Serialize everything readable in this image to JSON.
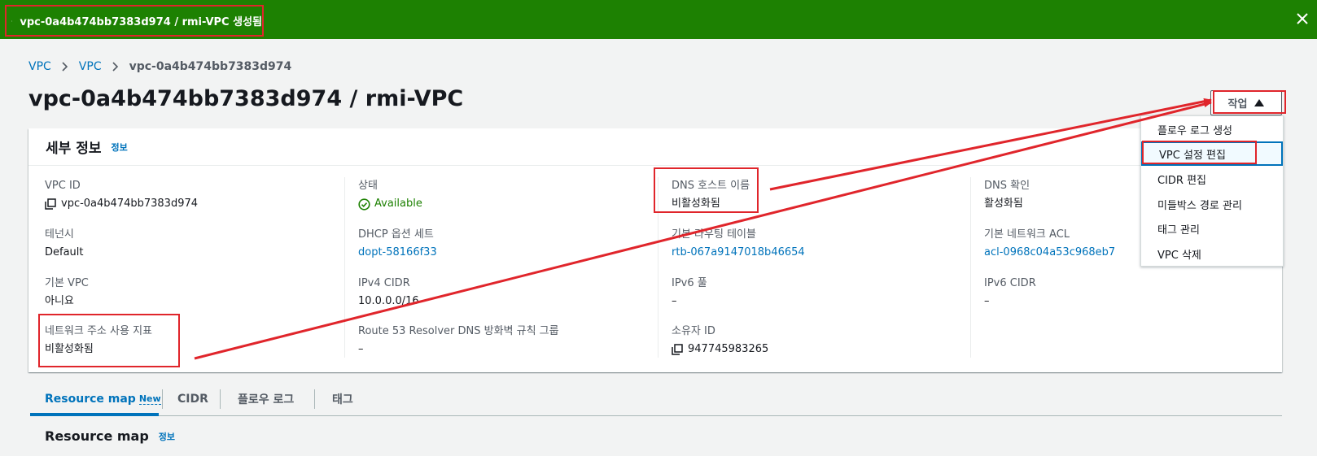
{
  "flash": {
    "message": "vpc-0a4b474bb7383d974 / rmi-VPC 생성됨",
    "color": "#1d8102"
  },
  "breadcrumb": {
    "items": [
      "VPC",
      "VPC"
    ],
    "current": "vpc-0a4b474bb7383d974"
  },
  "page_title": "vpc-0a4b474bb7383d974 / rmi-VPC",
  "actions_button": {
    "label": "작업"
  },
  "details": {
    "title": "세부 정보",
    "info": "정보",
    "vpc_id": {
      "label": "VPC ID",
      "value": "vpc-0a4b474bb7383d974"
    },
    "tenancy": {
      "label": "테넌시",
      "value": "Default"
    },
    "default_vpc": {
      "label": "기본 VPC",
      "value": "아니요"
    },
    "network_metrics": {
      "label": "네트워크 주소 사용 지표",
      "value": "비활성화됨"
    },
    "state": {
      "label": "상태",
      "value": "Available"
    },
    "dhcp": {
      "label": "DHCP 옵션 세트",
      "value": "dopt-58166f33"
    },
    "ipv4_cidr": {
      "label": "IPv4 CIDR",
      "value": "10.0.0.0/16"
    },
    "route53": {
      "label": "Route 53 Resolver DNS 방화벽 규칙 그룹",
      "value": "–"
    },
    "dns_hostnames": {
      "label": "DNS 호스트 이름",
      "value": "비활성화됨"
    },
    "main_route_table": {
      "label": "기본 라우팅 테이블",
      "value": "rtb-067a9147018b46654"
    },
    "ipv6_pool": {
      "label": "IPv6 풀",
      "value": "–"
    },
    "owner_id": {
      "label": "소유자 ID",
      "value": "947745983265"
    },
    "dns_resolution": {
      "label": "DNS 확인",
      "value": "활성화됨"
    },
    "main_acl": {
      "label": "기본 네트워크 ACL",
      "value": "acl-0968c04a53c968eb7"
    },
    "ipv6_cidr": {
      "label": "IPv6 CIDR",
      "value": "–"
    }
  },
  "dropdown": {
    "items": [
      "플로우 로그 생성",
      "VPC 설정 편집",
      "CIDR 편집",
      "미들박스 경로 관리",
      "태그 관리",
      "VPC 삭제"
    ],
    "active_index": 1
  },
  "tabs": {
    "items": [
      "Resource map",
      "CIDR",
      "플로우 로그",
      "태그"
    ],
    "new_badge": "New",
    "active": "Resource map"
  },
  "resource_map": {
    "title": "Resource map",
    "info": "정보"
  },
  "annotation_color": "#e0252b",
  "link_color": "#0073bb"
}
